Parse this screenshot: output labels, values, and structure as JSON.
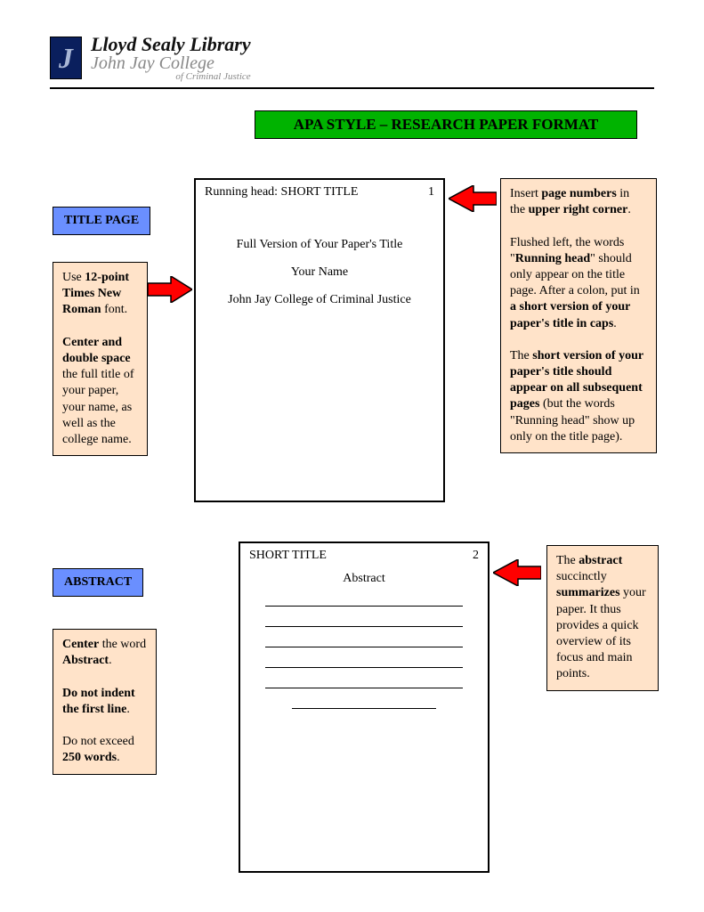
{
  "header": {
    "line1": "Lloyd Sealy Library",
    "line2": "John Jay College",
    "line3": "of Criminal Justice",
    "logo_letter": "J"
  },
  "title_bar": "APA STYLE – RESEARCH PAPER FORMAT",
  "tags": {
    "title_page": "TITLE PAGE",
    "abstract": "ABSTRACT"
  },
  "notes": {
    "font_note": {
      "l1a": "Use ",
      "l1b": "12-point Times New Roman",
      "l1c": " font.",
      "l2a": "Center and double space",
      "l2b": " the full title of your paper, your name, as well as the college name."
    },
    "abstract_note": {
      "l1a": "Center",
      "l1b": " the word ",
      "l1c": "Abstract",
      "l1d": ".",
      "l2a": "Do not indent the first line",
      "l2b": ".",
      "l3a": "Do not exceed ",
      "l3b": "250 words",
      "l3c": "."
    },
    "page_num_note": {
      "l1a": "Insert ",
      "l1b": "page numbers",
      "l1c": " in the ",
      "l1d": "upper right corner",
      "l1e": ".",
      "l2a": "Flushed left, the words \"",
      "l2b": "Running head",
      "l2c": "\" should only appear on the title page. After a colon, put in ",
      "l2d": "a short version of your paper's title in caps",
      "l2e": ".",
      "l3a": "The ",
      "l3b": "short version of your paper's title should appear on all subsequent pages",
      "l3c": " (but the words \"Running head\" show up only on the title page)."
    },
    "abstract_summary": {
      "l1a": "The ",
      "l1b": "abstract",
      "l1c": " succinctly ",
      "l1d": "summarizes",
      "l1e": " your paper. It thus provides a quick overview of its focus and main points."
    }
  },
  "page1": {
    "running_head": "Running head: SHORT TITLE",
    "page_num": "1",
    "full_title": "Full Version of Your Paper's Title",
    "your_name": "Your Name",
    "college": "John Jay College of Criminal Justice"
  },
  "page2": {
    "running_head": "SHORT TITLE",
    "page_num": "2",
    "section_title": "Abstract",
    "lines": [
      "____________________________________",
      "____________________________________",
      "____________________________________",
      "____________________________________",
      "____________________________________",
      "____________________________"
    ]
  },
  "colors": {
    "green": "#00b300",
    "blue": "#6a8fff",
    "peach": "#ffe3c9",
    "arrow": "#ff0000"
  }
}
